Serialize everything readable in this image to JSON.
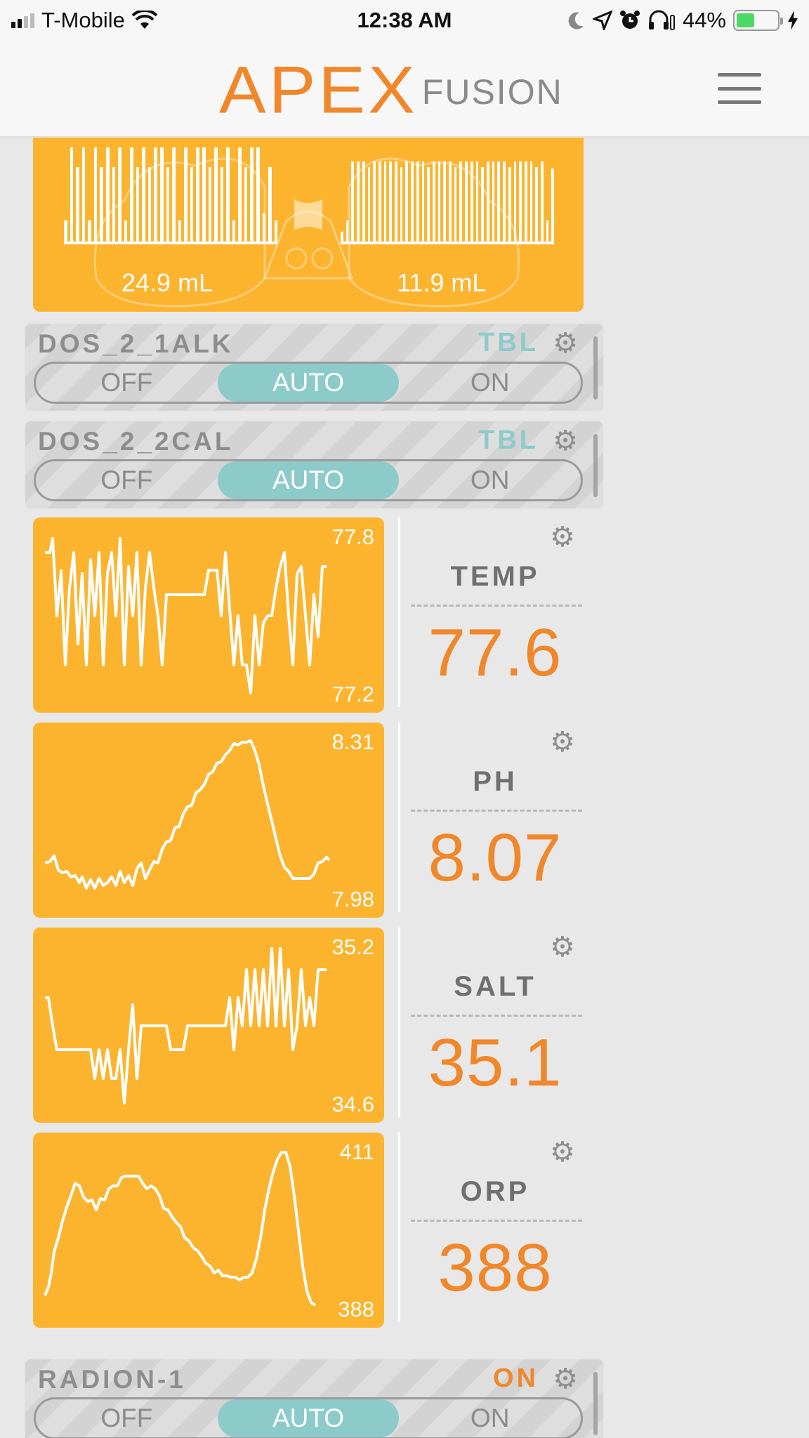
{
  "status_bar": {
    "carrier": "T-Mobile",
    "time": "12:38 AM",
    "battery_percent": "44%",
    "battery_level": 0.44,
    "icons": [
      "signal-icon",
      "wifi-icon",
      "moon-icon",
      "location-icon",
      "alarm-icon",
      "headphones-icon",
      "charging-icon"
    ]
  },
  "header": {
    "logo_primary": "APEX",
    "logo_secondary": "FUSION",
    "menu_icon": "hamburger-icon",
    "accent_color": "#f0872a"
  },
  "dosing": {
    "pump1_amount": "24.9 mL",
    "pump2_amount": "11.9 mL",
    "tile_color": "#fcb42f"
  },
  "outlets": [
    {
      "name": "DOS_2_1ALK",
      "state": "TBL",
      "state_color": "#8ccbca",
      "options": [
        "OFF",
        "AUTO",
        "ON"
      ],
      "selected": "AUTO"
    },
    {
      "name": "DOS_2_2CAL",
      "state": "TBL",
      "state_color": "#8ccbca",
      "options": [
        "OFF",
        "AUTO",
        "ON"
      ],
      "selected": "AUTO"
    },
    {
      "name": "RADION-1",
      "state": "ON",
      "state_color": "#f0872a",
      "options": [
        "OFF",
        "AUTO",
        "ON"
      ],
      "selected": "AUTO"
    }
  ],
  "probes": [
    {
      "name": "TEMP",
      "value": "77.6",
      "graph_max": "77.8",
      "graph_min": "77.2"
    },
    {
      "name": "PH",
      "value": "8.07",
      "graph_max": "8.31",
      "graph_min": "7.98"
    },
    {
      "name": "SALT",
      "value": "35.1",
      "graph_max": "35.2",
      "graph_min": "34.6"
    },
    {
      "name": "ORP",
      "value": "388",
      "graph_max": "411",
      "graph_min": "388"
    }
  ]
}
